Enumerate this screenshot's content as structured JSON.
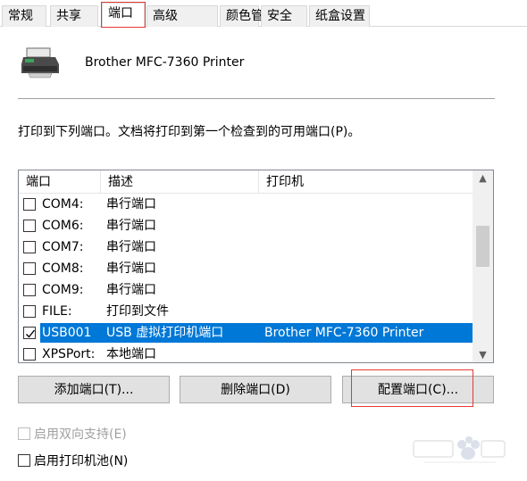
{
  "tabs": [
    {
      "label": "常规"
    },
    {
      "label": "共享"
    },
    {
      "label": "端口"
    },
    {
      "label": "高级"
    },
    {
      "label": "颜色管理"
    },
    {
      "label": "安全"
    },
    {
      "label": "纸盒设置"
    }
  ],
  "active_tab": "端口",
  "printer": {
    "name": "Brother MFC-7360 Printer",
    "icon": "printer-icon"
  },
  "description": "打印到下列端口。文档将打印到第一个检查到的可用端口(P)。",
  "ports_table": {
    "headers": [
      "端口",
      "描述",
      "打印机"
    ],
    "rows": [
      {
        "port": "COM4:",
        "desc": "串行端口",
        "printer": "",
        "checked": false,
        "selected": false
      },
      {
        "port": "COM6:",
        "desc": "串行端口",
        "printer": "",
        "checked": false,
        "selected": false
      },
      {
        "port": "COM7:",
        "desc": "串行端口",
        "printer": "",
        "checked": false,
        "selected": false
      },
      {
        "port": "COM8:",
        "desc": "串行端口",
        "printer": "",
        "checked": false,
        "selected": false
      },
      {
        "port": "COM9:",
        "desc": "串行端口",
        "printer": "",
        "checked": false,
        "selected": false
      },
      {
        "port": "FILE:",
        "desc": "打印到文件",
        "printer": "",
        "checked": false,
        "selected": false
      },
      {
        "port": "USB001",
        "desc": "USB 虚拟打印机端口",
        "printer": "Brother MFC-7360 Printer",
        "checked": true,
        "selected": true
      },
      {
        "port": "XPSPort:",
        "desc": "本地端口",
        "printer": "",
        "checked": false,
        "selected": false
      }
    ]
  },
  "buttons": {
    "add": "添加端口(T)...",
    "delete": "删除端口(D)",
    "configure": "配置端口(C)..."
  },
  "options": {
    "bidirectional": {
      "label": "启用双向支持(E)",
      "checked": false,
      "enabled": false
    },
    "pooling": {
      "label": "启用打印机池(N)",
      "checked": false,
      "enabled": true
    }
  },
  "colors": {
    "selection": "#0078d7",
    "highlight": "#e53935"
  }
}
